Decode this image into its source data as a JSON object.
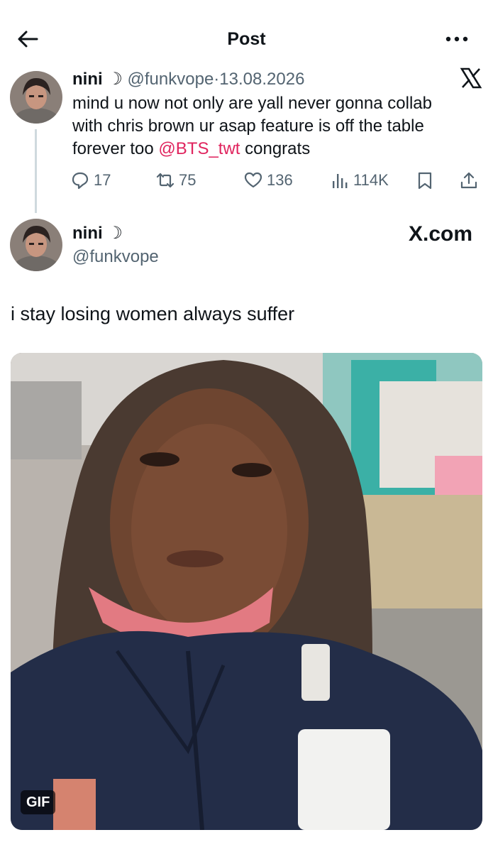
{
  "header": {
    "title": "Post"
  },
  "quoted": {
    "name": "nini ☽",
    "handle": "@funkvope",
    "separator": "·",
    "date": "13.08.2026",
    "text_before": "mind u now not only are yall never gonna collab with chris brown ur asap feature is off the table forever too ",
    "mention": "@BTS_twt",
    "text_after": " congrats",
    "replies": "17",
    "retweets": "75",
    "likes": "136",
    "views": "114K"
  },
  "main": {
    "name": "nini ☽",
    "handle": "@funkvope",
    "brand": "X.com",
    "text": "i stay losing women always suffer",
    "media_badge": "GIF"
  },
  "colors": {
    "text": "#0f1419",
    "muted": "#536471",
    "mention": "#e0245e",
    "thread_line": "#cfd9de"
  }
}
